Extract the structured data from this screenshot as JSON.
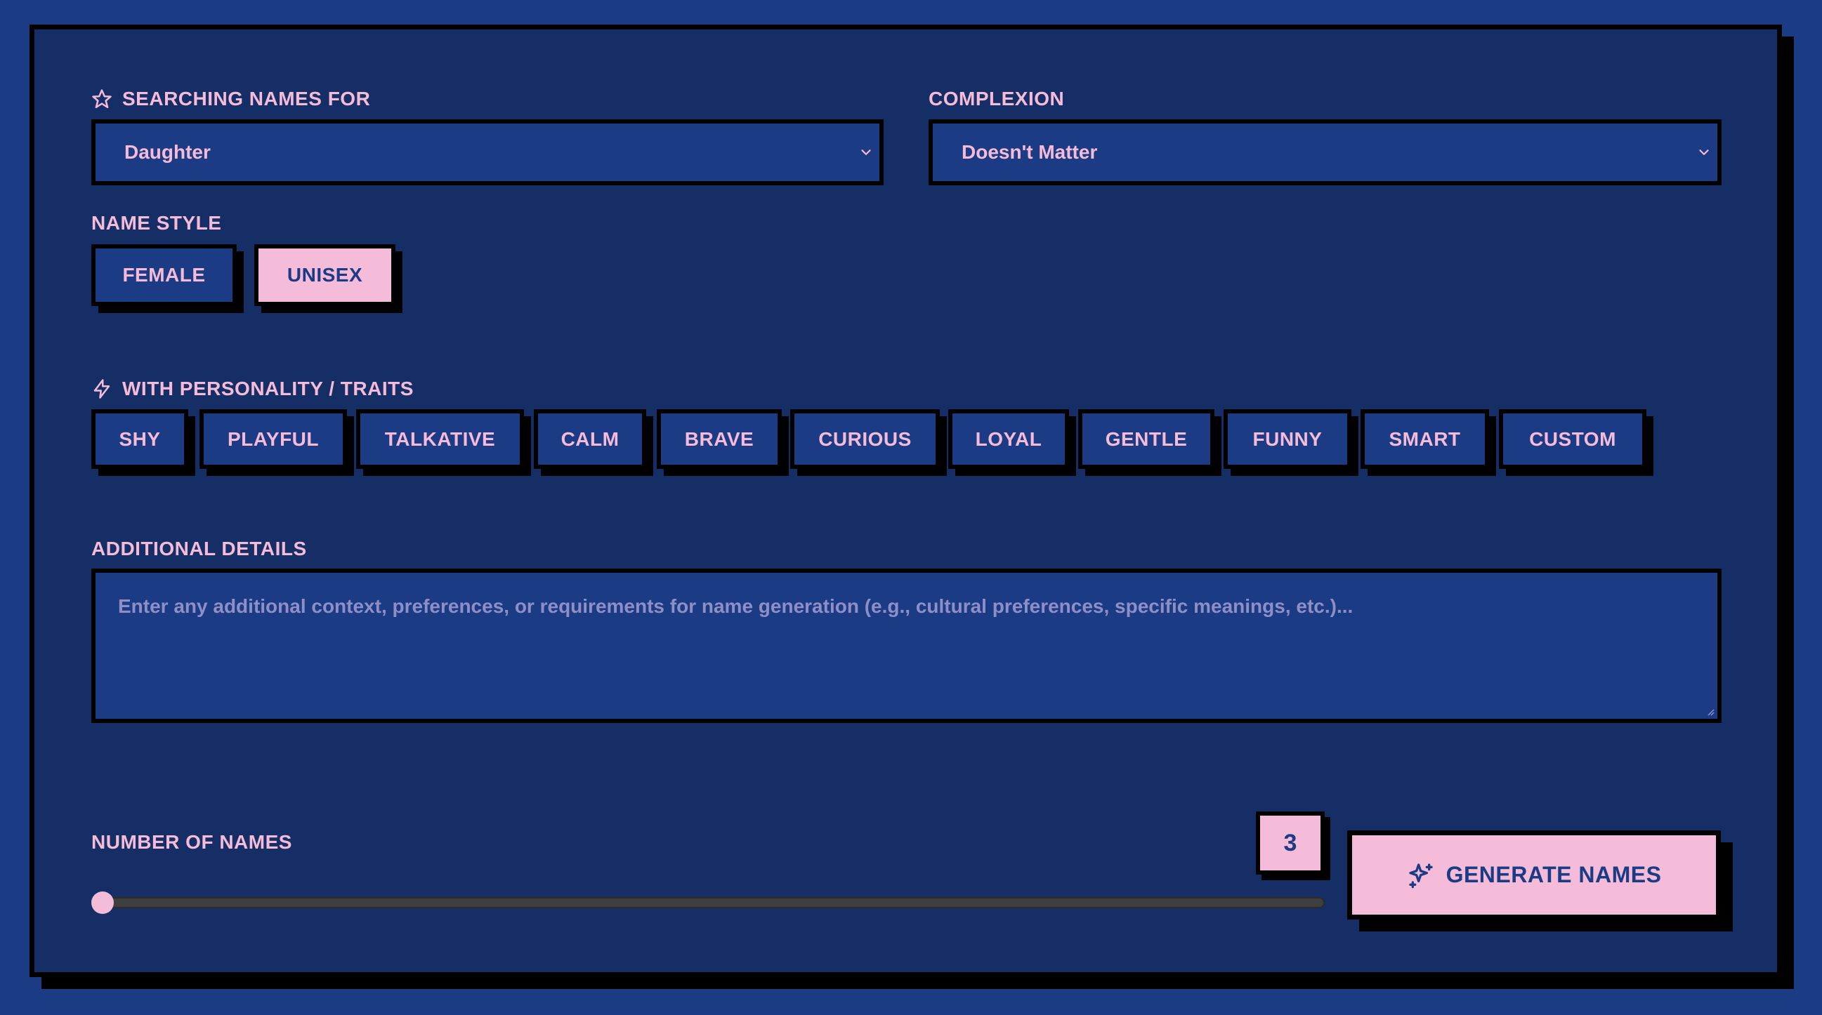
{
  "form": {
    "searching_label": "SEARCHING NAMES FOR",
    "searching_value": "Daughter",
    "complexion_label": "COMPLEXION",
    "complexion_value": "Doesn't Matter",
    "name_style_label": "NAME STYLE",
    "name_styles": [
      {
        "label": "FEMALE",
        "selected": false
      },
      {
        "label": "UNISEX",
        "selected": true
      }
    ],
    "traits_label": "WITH PERSONALITY / TRAITS",
    "traits": [
      "SHY",
      "PLAYFUL",
      "TALKATIVE",
      "CALM",
      "BRAVE",
      "CURIOUS",
      "LOYAL",
      "GENTLE",
      "FUNNY",
      "SMART",
      "CUSTOM"
    ],
    "details_label": "ADDITIONAL DETAILS",
    "details_placeholder": "Enter any additional context, preferences, or requirements for name generation (e.g., cultural preferences, specific meanings, etc.)...",
    "details_value": "",
    "count_label": "NUMBER OF NAMES",
    "count_value": "3",
    "generate_label": "GENERATE NAMES"
  },
  "icons": {
    "searching": "star-icon",
    "traits": "lightning-icon",
    "generate": "sparkles-icon",
    "dropdown": "chevron-down-icon"
  },
  "colors": {
    "background": "#1b3b85",
    "panel": "#152f66",
    "accent_pink": "#f5bcd9",
    "border": "#000000"
  }
}
